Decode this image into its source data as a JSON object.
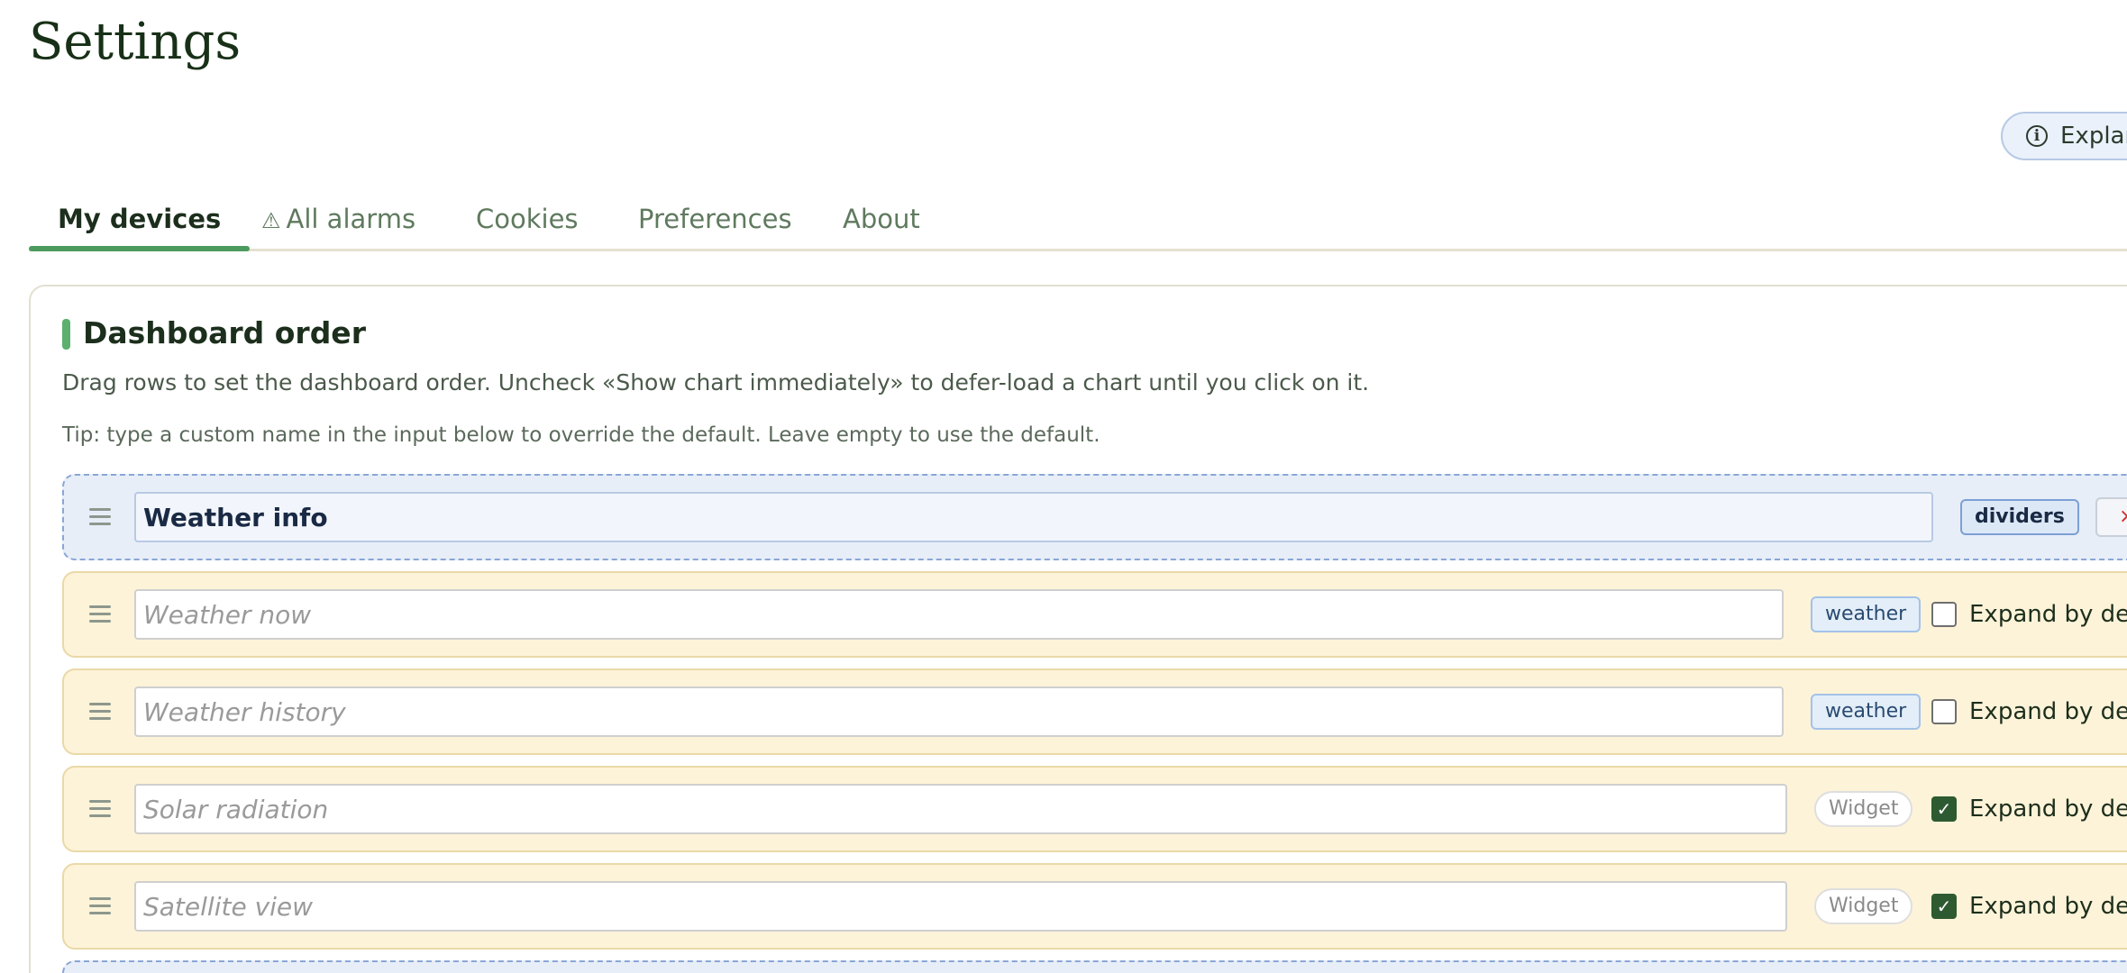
{
  "page": {
    "title": "Settings",
    "explain_button": "Explan"
  },
  "tabs": [
    {
      "label": "My devices",
      "active": true
    },
    {
      "label": "All alarms",
      "icon": "warning-icon"
    },
    {
      "label": "Cookies"
    },
    {
      "label": "Preferences"
    },
    {
      "label": "About"
    }
  ],
  "section": {
    "title": "Dashboard order",
    "description": "Drag rows to set the dashboard order. Uncheck «Show chart immediately» to defer-load a chart until you click on it.",
    "tip": "Tip: type a custom name in the input below to override the default. Leave empty to use the default."
  },
  "rows": [
    {
      "type": "divider",
      "value": "Weather info",
      "placeholder": "",
      "badge": "dividers",
      "remove": "×"
    },
    {
      "type": "widget",
      "value": "",
      "placeholder": "Weather now",
      "badge": "weather",
      "expand_label": "Expand by defau",
      "checked": false
    },
    {
      "type": "widget",
      "value": "",
      "placeholder": "Weather history",
      "badge": "weather",
      "expand_label": "Expand by defau",
      "checked": false
    },
    {
      "type": "widget",
      "value": "",
      "placeholder": "Solar radiation",
      "badge": "Widget",
      "expand_label": "Expand by defau",
      "checked": true
    },
    {
      "type": "widget",
      "value": "",
      "placeholder": "Satellite view",
      "badge": "Widget",
      "expand_label": "Expand by defau",
      "checked": true
    }
  ],
  "colors": {
    "accent": "#4c9a5e",
    "divider_row_bg": "#e7eef8",
    "widget_row_bg": "#fdf3d8",
    "checkbox_checked": "#2e5a32"
  }
}
